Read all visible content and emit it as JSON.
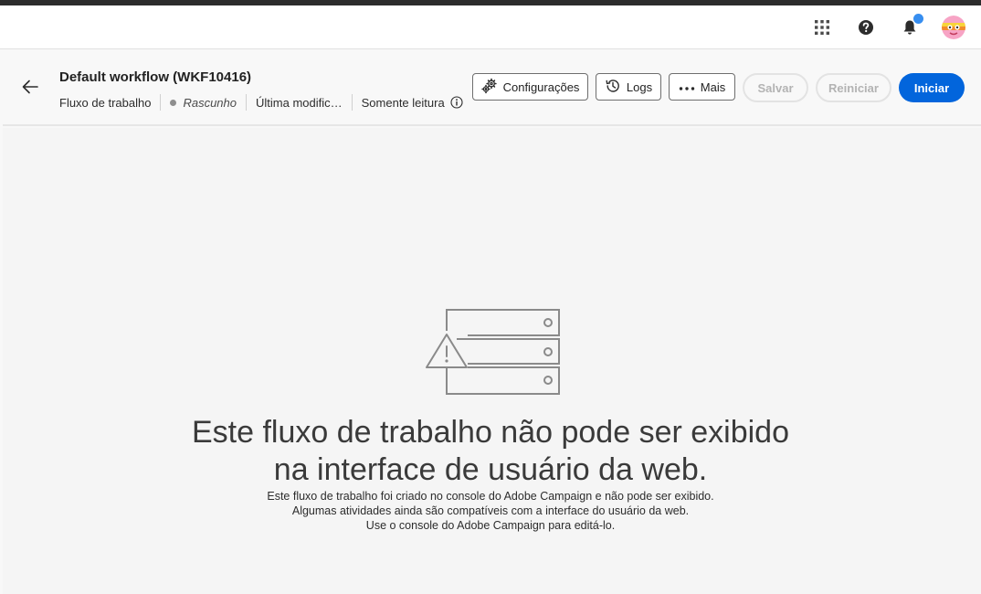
{
  "shell": {
    "apps_icon": "apps-grid-icon",
    "help_icon": "help-icon",
    "notifications_icon": "bell-icon",
    "notification_badge_color": "#378ef0",
    "avatar_icon": "user-avatar"
  },
  "header": {
    "title": "Default workflow (WKF10416)",
    "type": "Fluxo de trabalho",
    "status": "Rascunho",
    "last_modified": "Última modific…",
    "read_only": "Somente leitura",
    "buttons": {
      "settings": "Configurações",
      "logs": "Logs",
      "more": "Mais",
      "save": "Salvar",
      "restart": "Reiniciar",
      "start": "Iniciar"
    },
    "accent_color": "#0265dc"
  },
  "message": {
    "title_line1": "Este fluxo de trabalho não pode ser exibido",
    "title_line2": "na interface de usuário da web.",
    "body_line1": "Este fluxo de trabalho foi criado no console do Adobe Campaign e não pode ser exibido.",
    "body_line2": "Algumas atividades ainda são compatíveis com a interface do usuário da web.",
    "body_line3": "Use o console do Adobe Campaign para editá-lo."
  }
}
